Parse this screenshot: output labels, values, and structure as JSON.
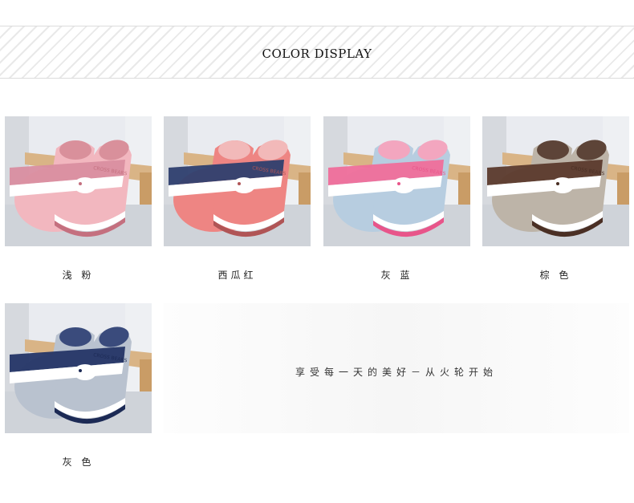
{
  "banner": {
    "title": "COLOR DISPLAY"
  },
  "products": [
    {
      "caption": "浅 粉",
      "logo": "CROSS BEARS",
      "colors": {
        "shoe": "#f2b7bf",
        "stripe": "#d98ea0",
        "sole": "#ffffff",
        "lining": "#d9909b",
        "accent": "#c4707f"
      }
    },
    {
      "caption": "西瓜红",
      "logo": "CROSS BEARS",
      "colors": {
        "shoe": "#ee8583",
        "stripe": "#2e3f6e",
        "sole": "#ffffff",
        "lining": "#f2b9b9",
        "accent": "#b05556"
      }
    },
    {
      "caption": "灰 蓝",
      "logo": "CROSS BEARS",
      "colors": {
        "shoe": "#b7cde0",
        "stripe": "#ef6e9a",
        "sole": "#ffffff",
        "lining": "#f3a6bf",
        "accent": "#e8558a"
      }
    },
    {
      "caption": "棕 色",
      "logo": "CROSS BEARS",
      "colors": {
        "shoe": "#bdb4a8",
        "stripe": "#5b3a2c",
        "sole": "#ffffff",
        "lining": "#5d4438",
        "accent": "#4a2f24"
      }
    },
    {
      "caption": "灰 色",
      "logo": "CROSS BEARS",
      "colors": {
        "shoe": "#b9c2cf",
        "stripe": "#243566",
        "sole": "#ffffff",
        "lining": "#3a4b7c",
        "accent": "#1c2a55"
      }
    }
  ],
  "slogan": "享受每一天的美好－从火轮开始"
}
